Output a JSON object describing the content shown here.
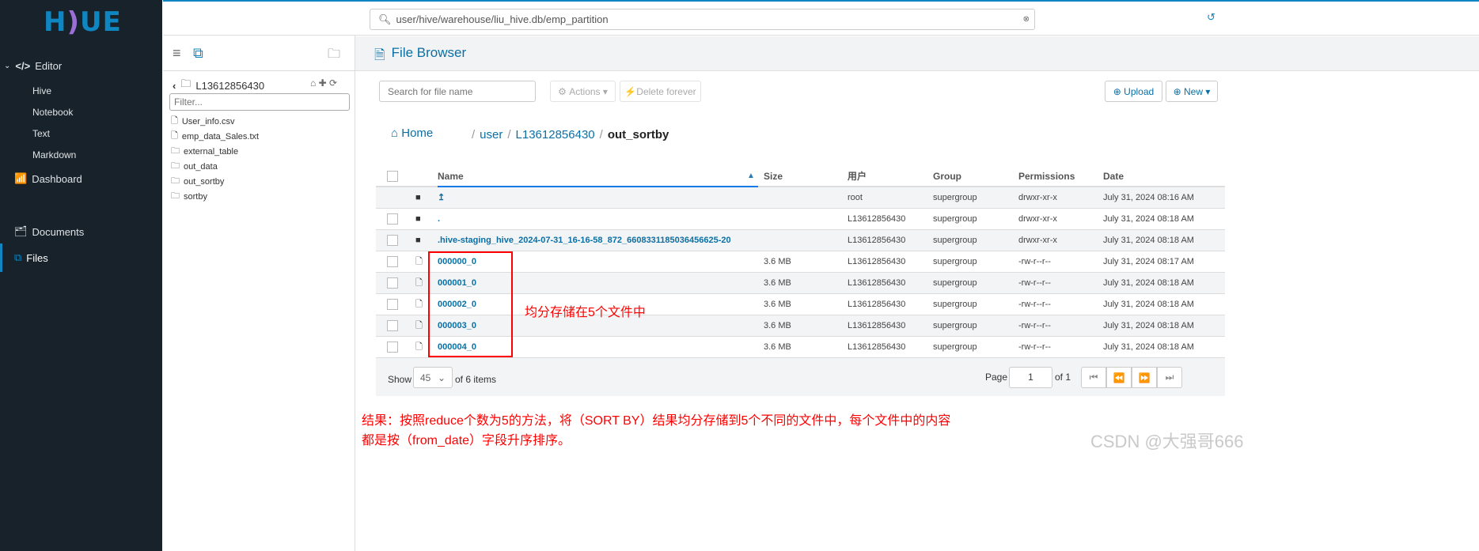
{
  "logo": "HUE",
  "sidebar": {
    "editor": "Editor",
    "items": [
      "Hive",
      "Notebook",
      "Text",
      "Markdown"
    ],
    "dashboard": "Dashboard",
    "documents": "Documents",
    "files": "Files"
  },
  "topbar": {
    "path": "user/hive/warehouse/liu_hive.db/emp_partition"
  },
  "middle": {
    "folder": "L13612856430",
    "filter_placeholder": "Filter...",
    "files": [
      {
        "name": "User_info.csv",
        "type": "file"
      },
      {
        "name": "emp_data_Sales.txt",
        "type": "file"
      },
      {
        "name": "external_table",
        "type": "folder"
      },
      {
        "name": "out_data",
        "type": "folder"
      },
      {
        "name": "out_sortby",
        "type": "folder"
      },
      {
        "name": "sortby",
        "type": "folder"
      }
    ]
  },
  "main": {
    "title": "File Browser",
    "search_placeholder": "Search for file name",
    "actions": "Actions",
    "delete": "Delete forever",
    "upload": "Upload",
    "new": "New",
    "breadcrumb": {
      "home": "Home",
      "parts": [
        "user",
        "L13612856430"
      ],
      "current": "out_sortby"
    },
    "columns": [
      "Name",
      "Size",
      "用户",
      "Group",
      "Permissions",
      "Date"
    ],
    "rows": [
      {
        "name": "↥",
        "type": "folder",
        "size": "",
        "user": "root",
        "group": "supergroup",
        "perm": "drwxr-xr-x",
        "date": "July 31, 2024 08:16 AM",
        "check": false
      },
      {
        "name": ".",
        "type": "folder",
        "size": "",
        "user": "L13612856430",
        "group": "supergroup",
        "perm": "drwxr-xr-x",
        "date": "July 31, 2024 08:18 AM",
        "check": true
      },
      {
        "name": ".hive-staging_hive_2024-07-31_16-16-58_872_6608331185036456625-20",
        "type": "folder",
        "size": "",
        "user": "L13612856430",
        "group": "supergroup",
        "perm": "drwxr-xr-x",
        "date": "July 31, 2024 08:18 AM",
        "check": true
      },
      {
        "name": "000000_0",
        "type": "file",
        "size": "3.6 MB",
        "user": "L13612856430",
        "group": "supergroup",
        "perm": "-rw-r--r--",
        "date": "July 31, 2024 08:17 AM",
        "check": true
      },
      {
        "name": "000001_0",
        "type": "file",
        "size": "3.6 MB",
        "user": "L13612856430",
        "group": "supergroup",
        "perm": "-rw-r--r--",
        "date": "July 31, 2024 08:18 AM",
        "check": true
      },
      {
        "name": "000002_0",
        "type": "file",
        "size": "3.6 MB",
        "user": "L13612856430",
        "group": "supergroup",
        "perm": "-rw-r--r--",
        "date": "July 31, 2024 08:18 AM",
        "check": true
      },
      {
        "name": "000003_0",
        "type": "file",
        "size": "3.6 MB",
        "user": "L13612856430",
        "group": "supergroup",
        "perm": "-rw-r--r--",
        "date": "July 31, 2024 08:18 AM",
        "check": true
      },
      {
        "name": "000004_0",
        "type": "file",
        "size": "3.6 MB",
        "user": "L13612856430",
        "group": "supergroup",
        "perm": "-rw-r--r--",
        "date": "July 31, 2024 08:18 AM",
        "check": true
      }
    ],
    "footer": {
      "show": "Show",
      "page_size": "45",
      "of_items": "of 6 items",
      "page_label": "Page",
      "page": "1",
      "of_pages": "of 1"
    }
  },
  "annotations": {
    "box_note": "均分存储在5个文件中",
    "result_line1": "结果：按照reduce个数为5的方法，将（SORT BY）结果均分存储到5个不同的文件中，每个文件中的内容",
    "result_line2": "都是按（from_date）字段升序排序。",
    "watermark": "CSDN @大强哥666"
  },
  "colors": {
    "accent": "#0f86c1",
    "sidebar": "#17222a",
    "annotation": "#ff0000"
  }
}
